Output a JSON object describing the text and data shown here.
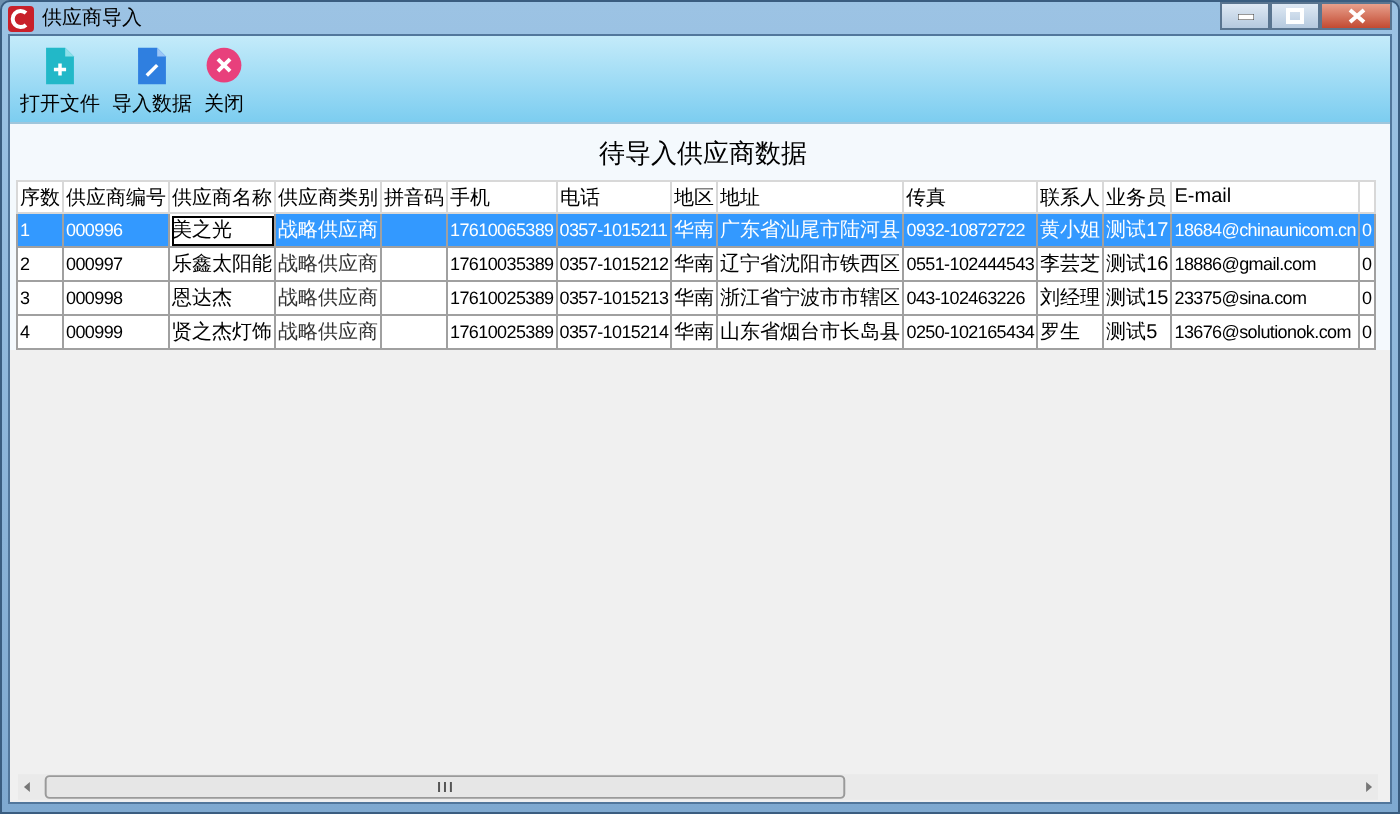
{
  "window": {
    "title": "供应商导入"
  },
  "toolbar": [
    {
      "kind": "open-file",
      "label": "打开文件"
    },
    {
      "kind": "import",
      "label": "导入数据"
    },
    {
      "kind": "close",
      "label": "关闭"
    }
  ],
  "heading": "待导入供应商数据",
  "table": {
    "columns": [
      "序数",
      "供应商编号",
      "供应商名称",
      "供应商类别",
      "拼音码",
      "手机",
      "电话",
      "地区",
      "地址",
      "传真",
      "联系人",
      "业务员",
      "E-mail"
    ],
    "rows": [
      {
        "selected": true,
        "name_editing": true,
        "cells": [
          "1",
          "000996",
          "美之光",
          "战略供应商",
          "",
          "17610065389",
          "0357-1015211",
          "华南",
          "广东省汕尾市陆河县",
          "0932-10872722",
          "黄小姐",
          "测试17",
          "18684@chinaunicom.cn",
          "0"
        ]
      },
      {
        "selected": false,
        "name_editing": false,
        "cells": [
          "2",
          "000997",
          "乐鑫太阳能",
          "战略供应商",
          "",
          "17610035389",
          "0357-1015212",
          "华南",
          "辽宁省沈阳市铁西区",
          "0551-102444543",
          "李芸芝",
          "测试16",
          "18886@gmail.com",
          "0"
        ]
      },
      {
        "selected": false,
        "name_editing": false,
        "cells": [
          "3",
          "000998",
          "恩达杰",
          "战略供应商",
          "",
          "17610025389",
          "0357-1015213",
          "华南",
          "浙江省宁波市市辖区",
          "043-102463226",
          "刘经理",
          "测试15",
          "23375@sina.com",
          "0"
        ]
      },
      {
        "selected": false,
        "name_editing": false,
        "cells": [
          "4",
          "000999",
          "贤之杰灯饰",
          "战略供应商",
          "",
          "17610025389",
          "0357-1015214",
          "华南",
          "山东省烟台市长岛县",
          "0250-102165434",
          "罗生",
          "测试5",
          "13676@solutionok.com",
          "0"
        ]
      }
    ]
  }
}
